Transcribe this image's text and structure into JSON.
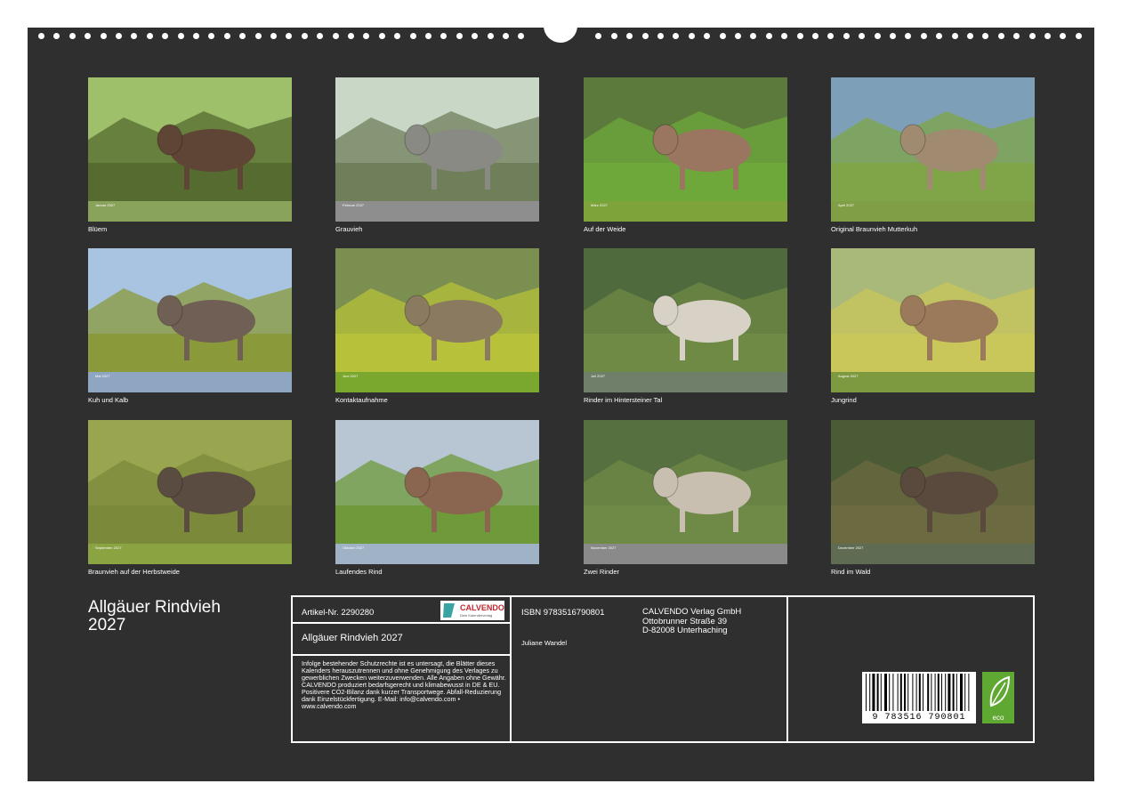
{
  "calendar": {
    "title_line1": "Allgäuer Rindvieh",
    "title_line2": "2027",
    "months": [
      {
        "month": "Januar 2027",
        "caption": "Blüem",
        "strip_color": "#8aa35a"
      },
      {
        "month": "Februar 2027",
        "caption": "Grauvieh",
        "strip_color": "#8e8e8e"
      },
      {
        "month": "März 2027",
        "caption": "Auf der Weide",
        "strip_color": "#7ea33a"
      },
      {
        "month": "April 2027",
        "caption": "Original Braunvieh Mutterkuh",
        "strip_color": "#7f9e45"
      },
      {
        "month": "Mai 2027",
        "caption": "Kuh und Kalb",
        "strip_color": "#8fa6c2"
      },
      {
        "month": "Juni 2027",
        "caption": "Kontaktaufnahme",
        "strip_color": "#7aa72e"
      },
      {
        "month": "Juli 2027",
        "caption": "Rinder im Hintersteiner Tal",
        "strip_color": "#6f7f6a"
      },
      {
        "month": "August 2027",
        "caption": "Jungrind",
        "strip_color": "#7d9a40"
      },
      {
        "month": "September 2027",
        "caption": "Braunvieh auf der Herbstweide",
        "strip_color": "#8ba442"
      },
      {
        "month": "Oktober 2027",
        "caption": "Laufendes Rind",
        "strip_color": "#9fb2c6"
      },
      {
        "month": "November 2027",
        "caption": "Zwei Rinder",
        "strip_color": "#8a8a8a"
      },
      {
        "month": "Dezember 2027",
        "caption": "Rind im Wald",
        "strip_color": "#5f6b52"
      }
    ]
  },
  "info": {
    "article": "Artikel-Nr. 2290280",
    "calvendo_logo_text": "CALVENDO",
    "calvendo_logo_sub": "Dein Kalenderverlag",
    "product_title": "Allgäuer Rindvieh 2027",
    "legal_text": "Infolge bestehender Schutzrechte ist es untersagt, die Blätter dieses Kalenders herauszutrennen und ohne Genehmigung des Verlages zu gewerblichen Zwecken weiterzuverwenden. Alle Angaben ohne Gewähr. CALVENDO produziert bedarfsgerecht und klimabewusst in DE & EU. Positivere CO2-Bilanz dank kurzer Transportwege. Abfall-Reduzierung dank Einzelstückfertigung. E-Mail: info@calvendo.com • www.calvendo.com",
    "isbn": "ISBN 9783516790801",
    "author": "Juliane Wandel",
    "publisher_line1": "CALVENDO Verlag GmbH",
    "publisher_line2": "Ottobrunner Straße 39",
    "publisher_line3": "D-82008 Unterhaching",
    "barcode_number": "9 783516 790801",
    "eco_label": "eco"
  }
}
